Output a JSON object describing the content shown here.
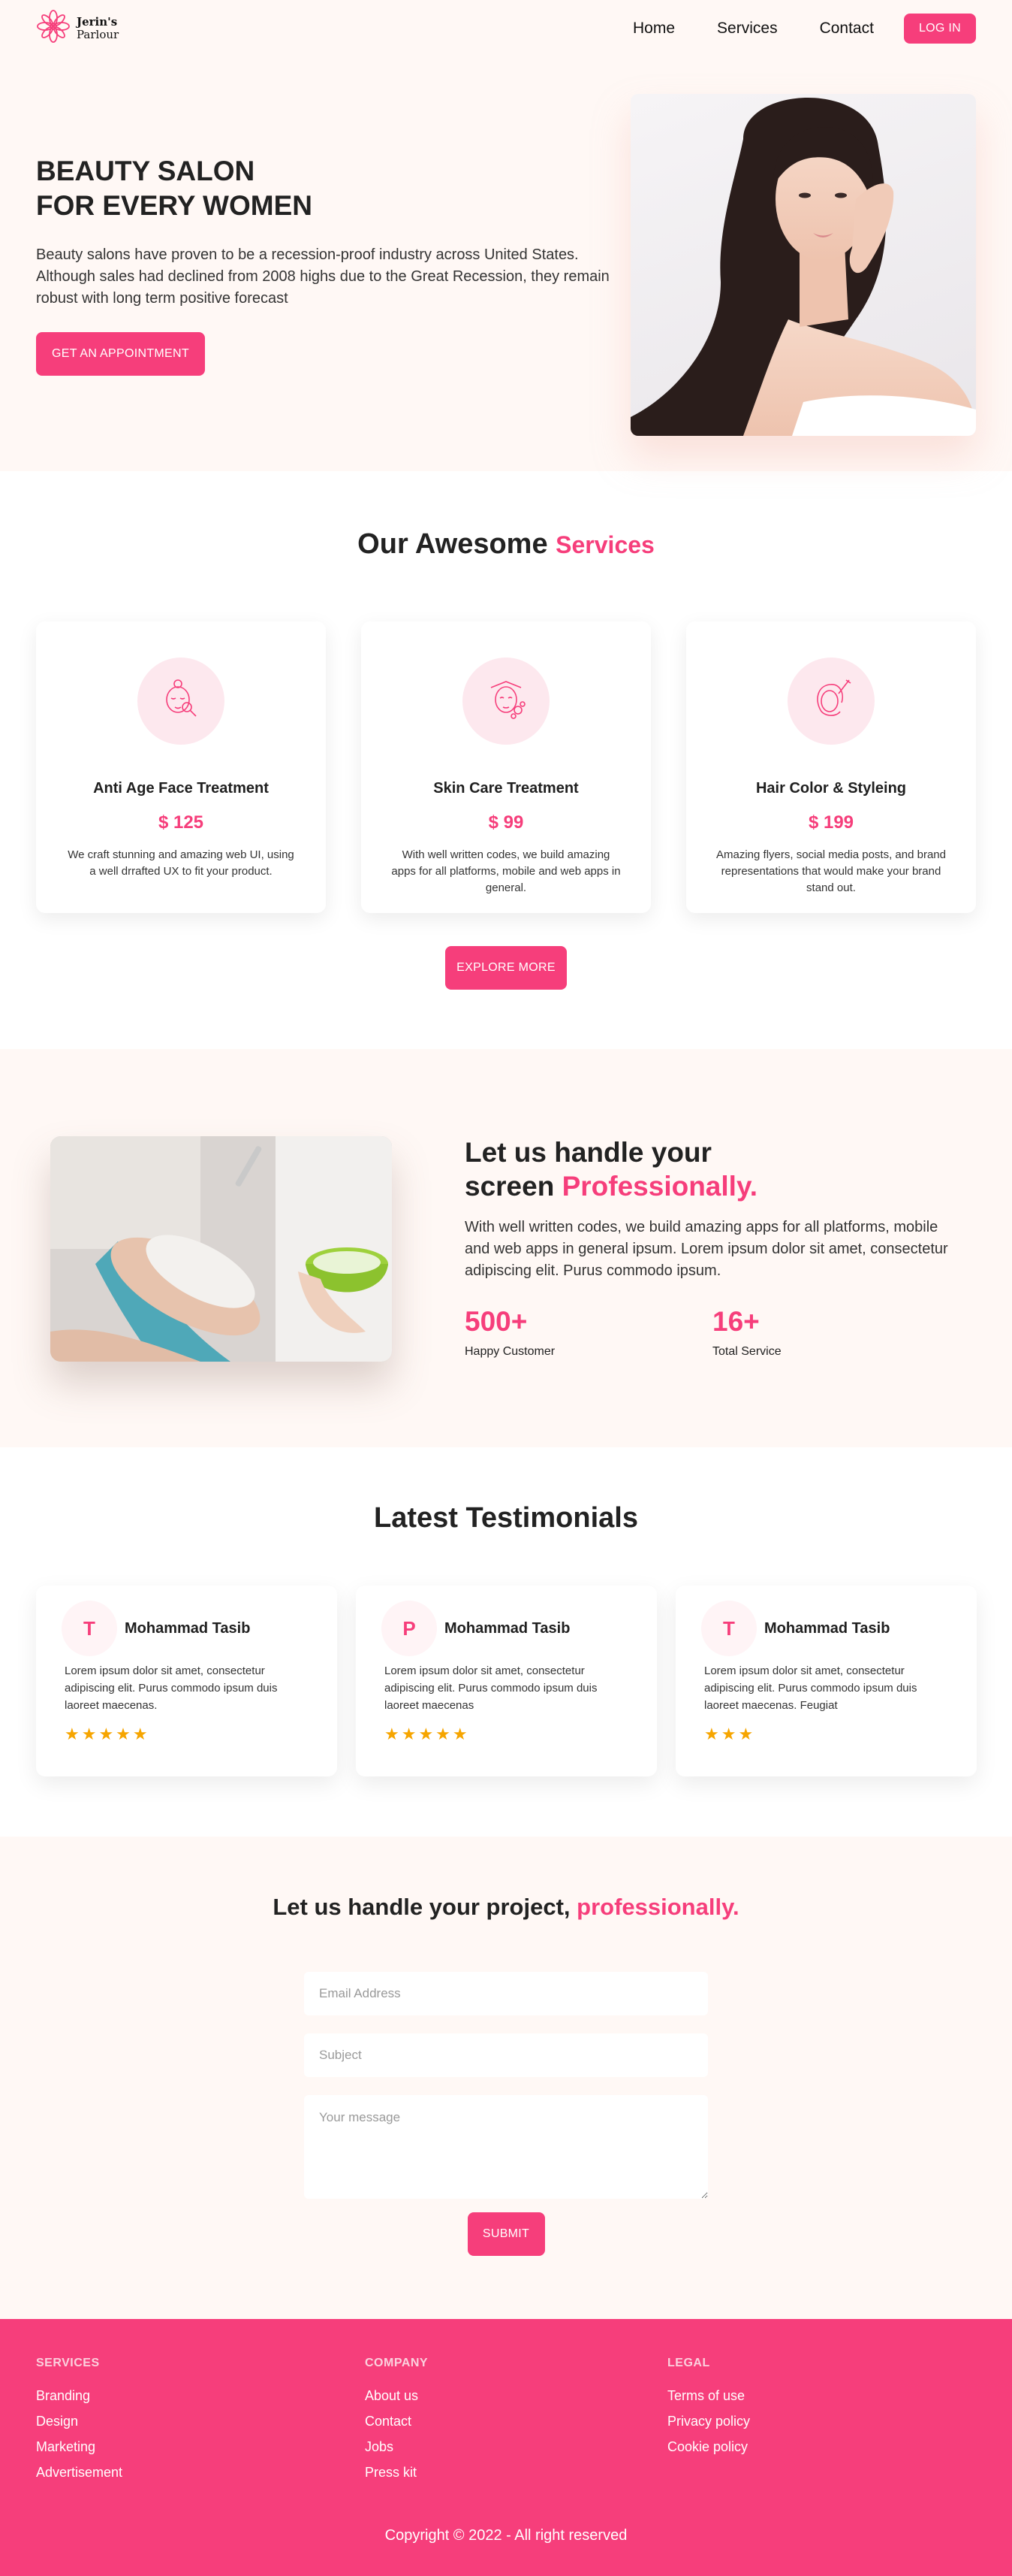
{
  "colors": {
    "accent": "#f63e7b",
    "cream": "#fff8f5",
    "star": "#f6a500"
  },
  "header": {
    "brand_name": "Jerin's",
    "brand_sub": "Parlour",
    "logo_icon": "flower-icon",
    "nav": [
      {
        "label": "Home"
      },
      {
        "label": "Services"
      },
      {
        "label": "Contact"
      }
    ],
    "login_label": "LOG IN"
  },
  "hero": {
    "title_line1": "BEAUTY SALON",
    "title_line2": "FOR EVERY WOMEN",
    "description": "Beauty salons have proven to be a recession-proof industry across United States. Although sales had declined from 2008 highs due to the Great Recession, they remain robust with long term positive forecast",
    "cta_label": "GET AN APPOINTMENT"
  },
  "services": {
    "title_main": "Our Awesome",
    "title_accent": "Services",
    "cards": [
      {
        "icon": "face-treatment-icon",
        "name": "Anti Age Face Treatment",
        "price": "$ 125",
        "description": "We craft stunning and amazing web UI, using a well drrafted UX to fit your product."
      },
      {
        "icon": "skin-care-icon",
        "name": "Skin Care Treatment",
        "price": "$ 99",
        "description": "With well written codes, we build amazing apps for all platforms, mobile and web apps in general."
      },
      {
        "icon": "hair-color-icon",
        "name": "Hair Color & Styleing",
        "price": "$ 199",
        "description": "Amazing flyers, social media posts, and brand representations that would make your brand stand out."
      }
    ],
    "explore_label": "EXPLORE MORE"
  },
  "professional": {
    "title_line1": "Let us handle your",
    "title_line2_main": "screen",
    "title_line2_accent": "Professionally.",
    "description": "With well written codes, we build amazing apps for all platforms, mobile and web apps in general ipsum. Lorem ipsum dolor sit amet, consectetur adipiscing elit. Purus commodo ipsum.",
    "stats": [
      {
        "number": "500+",
        "label": "Happy Customer"
      },
      {
        "number": "16+",
        "label": "Total Service"
      }
    ]
  },
  "testimonials": {
    "title": "Latest Testimonials",
    "cards": [
      {
        "initial": "T",
        "name": "Mohammad Tasib",
        "text": "Lorem ipsum dolor sit amet, consectetur adipiscing elit. Purus commodo ipsum duis laoreet maecenas.",
        "stars": "★★★★★",
        "rating": 5
      },
      {
        "initial": "P",
        "name": "Mohammad Tasib",
        "text": "Lorem ipsum dolor sit amet, consectetur adipiscing elit. Purus commodo ipsum duis laoreet maecenas",
        "stars": "★★★★★",
        "rating": 5
      },
      {
        "initial": "T",
        "name": "Mohammad Tasib",
        "text": "Lorem ipsum dolor sit amet, consectetur adipiscing elit. Purus commodo ipsum duis laoreet maecenas. Feugiat",
        "stars": "★★★",
        "rating": 3
      }
    ]
  },
  "contact": {
    "title_main": "Let us handle your project,",
    "title_accent": "professionally.",
    "email_placeholder": "Email Address",
    "subject_placeholder": "Subject",
    "message_placeholder": "Your message",
    "submit_label": "SUBMIT"
  },
  "footer": {
    "columns": [
      {
        "heading": "SERVICES",
        "links": [
          "Branding",
          "Design",
          "Marketing",
          "Advertisement"
        ]
      },
      {
        "heading": "COMPANY",
        "links": [
          "About us",
          "Contact",
          "Jobs",
          "Press kit"
        ]
      },
      {
        "heading": "LEGAL",
        "links": [
          "Terms of use",
          "Privacy policy",
          "Cookie policy"
        ]
      }
    ],
    "copyright": "Copyright © 2022 - All right reserved"
  }
}
